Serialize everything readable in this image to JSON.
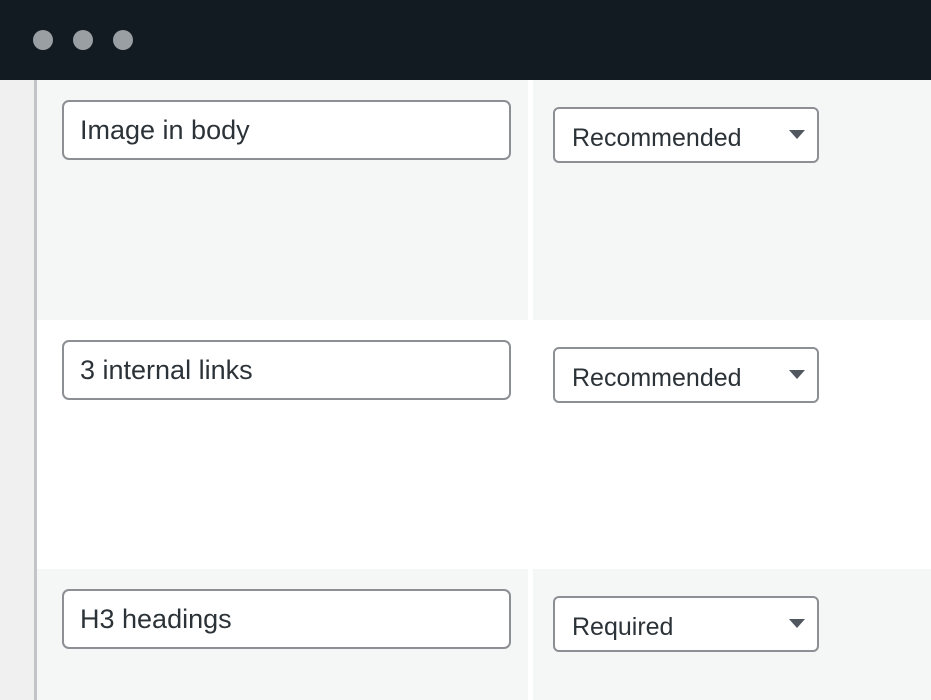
{
  "window": {
    "controls": [
      "close-dot",
      "minimize-dot",
      "zoom-dot"
    ]
  },
  "rows": [
    {
      "field_value": "Image in body",
      "requirement": "Recommended"
    },
    {
      "field_value": "3 internal links",
      "requirement": "Recommended"
    },
    {
      "field_value": "H3 headings",
      "requirement": "Required"
    }
  ],
  "colors": {
    "titlebar": "#121b21",
    "row_shade": "#f5f6f6",
    "border": "#8c8f94",
    "text": "#2c3338"
  }
}
